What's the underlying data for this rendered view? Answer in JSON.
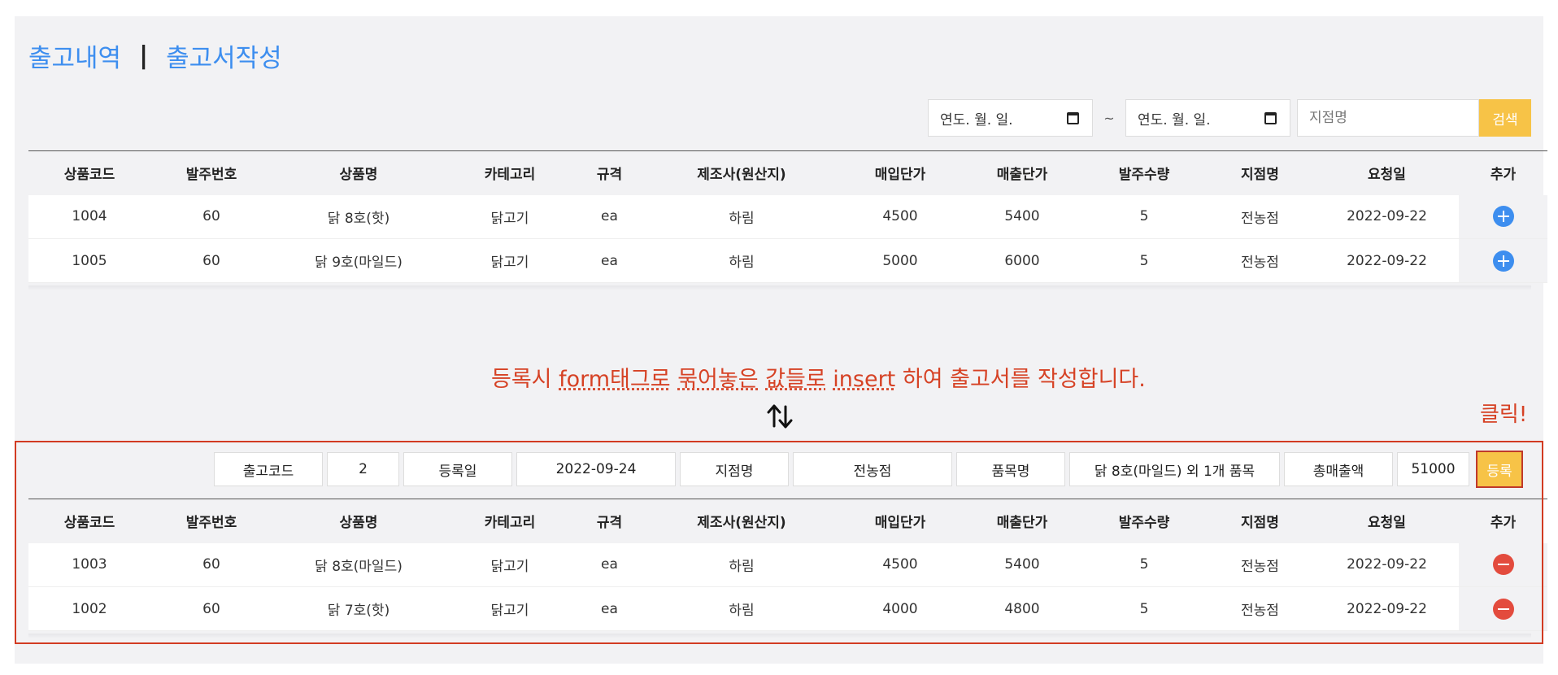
{
  "header": {
    "tab_list": "출고내역",
    "separator": "|",
    "tab_write": "출고서작성"
  },
  "search": {
    "date_from_placeholder": "연도. 월. 일.",
    "tilde": "~",
    "date_to_placeholder": "연도. 월. 일.",
    "branch_placeholder": "지점명",
    "button": "검색"
  },
  "table_columns": [
    "상품코드",
    "발주번호",
    "상품명",
    "카테고리",
    "규격",
    "제조사(원산지)",
    "매입단가",
    "매출단가",
    "발주수량",
    "지점명",
    "요청일",
    "추가"
  ],
  "available_items": [
    [
      "1004",
      "60",
      "닭 8호(핫)",
      "닭고기",
      "ea",
      "하림",
      "4500",
      "5400",
      "5",
      "전농점",
      "2022-09-22"
    ],
    [
      "1005",
      "60",
      "닭 9호(마일드)",
      "닭고기",
      "ea",
      "하림",
      "5000",
      "6000",
      "5",
      "전농점",
      "2022-09-22"
    ]
  ],
  "annotation": {
    "part1": "등록시 ",
    "part2": "form태그로",
    "part3": " ",
    "part4": "묶어놓은",
    "part5": " ",
    "part6": "값들로",
    "part7": " ",
    "part8": "insert",
    "part9": " 하여 출고서를 작성합니다."
  },
  "click_label": "클릭!",
  "form": {
    "code_label": "출고코드",
    "code_value": "2",
    "date_label": "등록일",
    "date_value": "2022-09-24",
    "branch_label": "지점명",
    "branch_value": "전농점",
    "item_label": "품목명",
    "item_value": "닭 8호(마일드) 외 1개 품목",
    "total_label": "총매출액",
    "total_value": "51000",
    "register_button": "등록"
  },
  "selected_items": [
    [
      "1003",
      "60",
      "닭 8호(마일드)",
      "닭고기",
      "ea",
      "하림",
      "4500",
      "5400",
      "5",
      "전농점",
      "2022-09-22"
    ],
    [
      "1002",
      "60",
      "닭 7호(핫)",
      "닭고기",
      "ea",
      "하림",
      "4000",
      "4800",
      "5",
      "전농점",
      "2022-09-22"
    ]
  ],
  "colors": {
    "link": "#3d8eef",
    "accent": "#f7c347",
    "annotation": "#d64225",
    "add": "#3d8eef",
    "remove": "#e34b3d"
  },
  "icons": {
    "add": "plus-circle-icon",
    "remove": "minus-circle-icon",
    "swap": "swap-arrows-icon",
    "calendar": "calendar-icon"
  }
}
